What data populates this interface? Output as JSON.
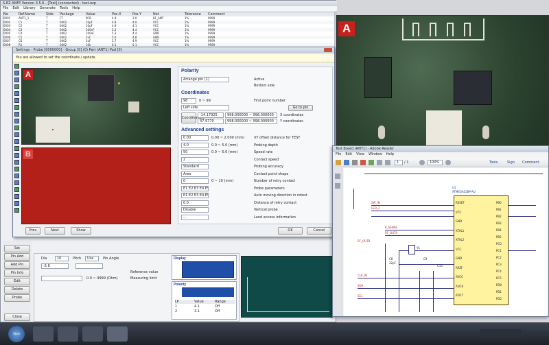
{
  "app": {
    "title": "S-EZ ANFP Version 3.5.6 - [Test] (connected) - test.ezp",
    "menu": [
      "File",
      "Edit",
      "Library",
      "Generate",
      "Tools",
      "Help"
    ],
    "table_headers": [
      "No",
      "Ref.Name",
      "Side",
      "Package",
      "Value",
      "Pos.X",
      "Pos.Y",
      "Net",
      "Tolerance",
      "Comment"
    ],
    "table_rows": [
      [
        "0001",
        "ANT1_1",
        "T",
        "FT",
        "PCB",
        "4.4",
        "3.0",
        "RF_ANT",
        "1%",
        "9999"
      ],
      [
        "0002",
        "C1",
        "T",
        "0402",
        "10pF",
        "4.8",
        "4.0",
        "VCC",
        "1%",
        "9999"
      ],
      [
        "0003",
        "C2",
        "T",
        "0402",
        "10pF",
        "4.9",
        "4.1",
        "VCC",
        "1%",
        "9999"
      ],
      [
        "0004",
        "C3",
        "T",
        "0402",
        "100nF",
        "5.2",
        "4.4",
        "VCC",
        "1%",
        "9999"
      ],
      [
        "0005",
        "C4",
        "T",
        "0402",
        "100nF",
        "5.3",
        "4.4",
        "GND",
        "1%",
        "9999"
      ],
      [
        "0006",
        "C5",
        "T",
        "0402",
        "1uF",
        "5.6",
        "4.8",
        "GND",
        "1%",
        "9999"
      ],
      [
        "0007",
        "C6",
        "T",
        "0402",
        "1uF",
        "5.7",
        "4.9",
        "VCC",
        "1%",
        "9999"
      ],
      [
        "0008",
        "R1",
        "T",
        "0402",
        "10k",
        "6.1",
        "5.1",
        "VCC",
        "1%",
        "9999"
      ]
    ]
  },
  "settings_dialog": {
    "title": "Settings - Probe [0000000] - Group [0] (0) Part (ANT1) Pad [0]",
    "info_banner": "You are allowed to set the coordinate / update.",
    "marker_a": "A",
    "marker_b": "B",
    "polarity": {
      "header": "Polarity",
      "select_value": "Arrange pin (1)",
      "option_top": "Active",
      "option_bottom": "Bottom side"
    },
    "coordinates": {
      "header": "Coordinates",
      "start": "98",
      "range": "0 ~ 99",
      "first_label": "First point number",
      "select_value": "Left side",
      "next_button": "Go to pin",
      "row1_label": "Coordination",
      "row1_x": "-14.17925",
      "row1_y": "998.000000 ~ 998.000000",
      "row1_tail": "X coordinates",
      "row2_x": "47.9770",
      "row2_y": "998.000000 ~ 998.000000",
      "row2_tail": "Y coordinates"
    },
    "advanced": {
      "header": "Advanced settings",
      "rows": [
        {
          "value": "0.00",
          "range": "0.00 ~ 2.000 (mm)",
          "label": "XY offset distance for TEST"
        },
        {
          "value": "4.0",
          "range": "0.0 ~ 5.0 (mm)",
          "label": "Probing depth"
        },
        {
          "value": "50",
          "range": "0.0 ~ 5.0 (mm)",
          "label": "Speed rate"
        },
        {
          "value": "2",
          "range": "",
          "label": "Contact speed"
        },
        {
          "value": "Standard",
          "range": "",
          "label": "Probing accuracy"
        },
        {
          "value": "Area",
          "range": "",
          "label": "Contact point shape"
        },
        {
          "value": "0",
          "range": "0 ~ 10 (mm)",
          "label": "Number of retry contact"
        },
        {
          "value": "E1 E2 E3 E4 E5",
          "range": "",
          "label": "Probe parameters"
        },
        {
          "value": "E1 E2 E3 E4 E5",
          "range": "",
          "label": "Auto moving direction in retest"
        },
        {
          "value": "0.0",
          "range": "",
          "label": "Distance of retry contact"
        },
        {
          "value": "Disable",
          "range": "",
          "label": "Vertical probe"
        },
        {
          "value": "...",
          "range": "",
          "label": "Land access information"
        }
      ]
    },
    "buttons": {
      "prev": "Prev",
      "next": "Next",
      "show": "Show",
      "ok": "OK",
      "cancel": "Cancel"
    }
  },
  "left_panel": {
    "buttons": [
      "Set",
      "Pin Add",
      "Add Pin",
      "Pin Info",
      "Edit",
      "Delete",
      "Probe"
    ],
    "bottom_button": "Close"
  },
  "bottom_panel": {
    "labels": [
      "Dia",
      "Pitch",
      "Pin Angle"
    ],
    "values": [
      "10",
      "Use",
      "-5.8"
    ],
    "row_label1": "Reference value",
    "row_label2": "Measuring limit",
    "row_value": "0.0 ~ 9999 (Ohm)",
    "display_title": "Display",
    "polarity_title": "Polarity",
    "grid_headers": [
      "LP",
      "Value",
      "Range"
    ],
    "grid_rows": [
      [
        "1",
        "4.1",
        "Off"
      ],
      [
        "2",
        "3.1",
        "Off"
      ]
    ]
  },
  "pdf_window": {
    "title": "Test Board (ANT1) - Adobe Reader",
    "menu": [
      "File",
      "Edit",
      "View",
      "Window",
      "Help"
    ],
    "page": "1",
    "pages": "/ 1",
    "zoom": "100%",
    "tools": "Tools",
    "sign": "Sign",
    "comment": "Comment",
    "chip_label": "U1",
    "chip_part": "ATMEGA328P-AU",
    "chip_left": [
      "RESET",
      "VCC",
      "GND",
      "XTAL1",
      "XTAL2",
      "VCC",
      "GND",
      "AREF",
      "AVCC",
      "ADC6",
      "ADC7"
    ],
    "chip_right": [
      "PB0",
      "PB1",
      "PB2",
      "PB3",
      "PB4",
      "PB5",
      "PC0",
      "PC1",
      "PC2",
      "PC3",
      "PC4",
      "PC5",
      "PD0",
      "PD1",
      "PD2"
    ],
    "net_labels": [
      "SW_IN",
      "LED_2",
      "R_SENSE",
      "RF_OUTA",
      "RF_OUTB",
      "CLK_IN",
      "SDA",
      "SCL"
    ],
    "crystal": "Y1",
    "caps": [
      "C8",
      "C9",
      "C10"
    ],
    "cap_value": "22pF"
  },
  "camera": {
    "marker": "A"
  },
  "taskbar": {
    "start": "Start"
  },
  "colors": {
    "window_blue": "#2a4f8f",
    "red_canvas": "#b32019",
    "chip_fill": "#fff3a0",
    "schematic_blue": "#2a2a80",
    "pcb_green": "#3a5b3d"
  }
}
